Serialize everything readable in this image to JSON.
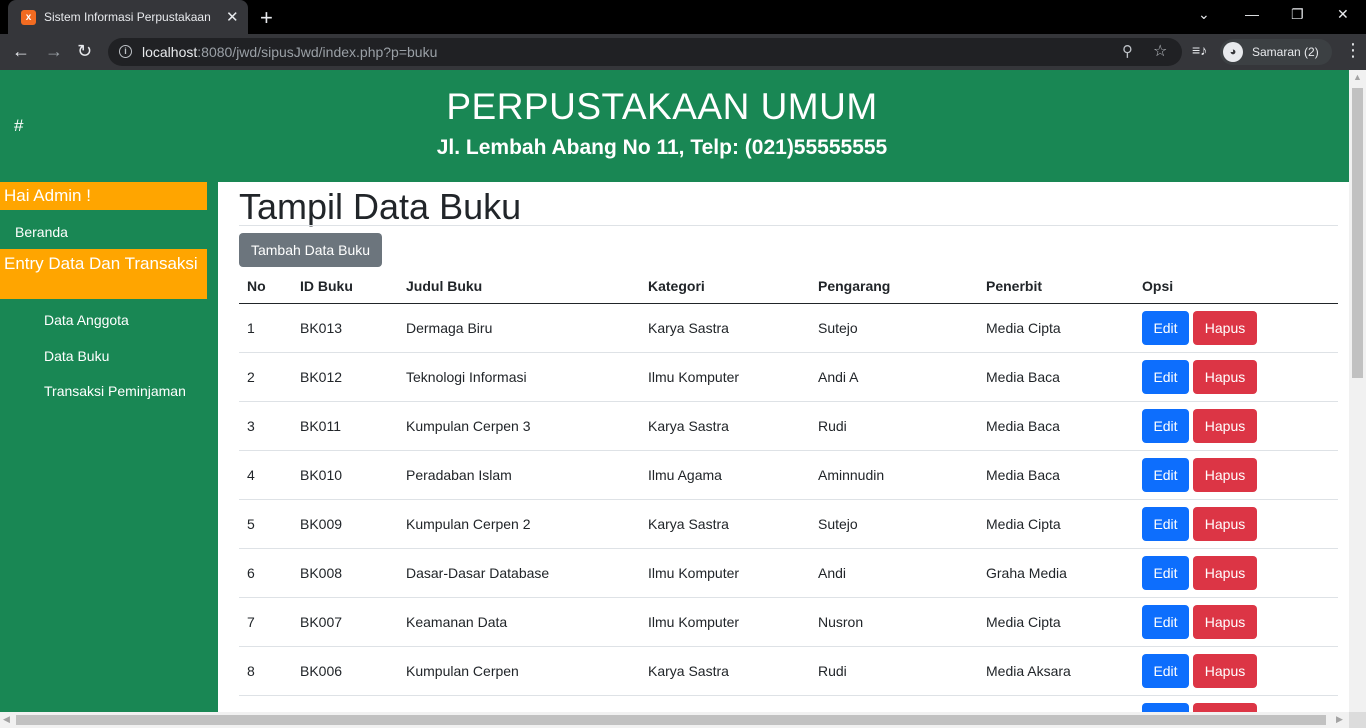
{
  "browser": {
    "tab_title": "Sistem Informasi Perpustakaan",
    "url_host": "localhost",
    "url_rest": ":8080/jwd/sipusJwd/index.php?p=buku",
    "profile_label": "Samaran (2)",
    "icons": [
      "back-icon",
      "forward-icon",
      "reload-icon",
      "info-icon",
      "zoom-icon",
      "star-icon",
      "media-icon",
      "incognito-icon",
      "menu-icon"
    ]
  },
  "header": {
    "hash": "#",
    "title": "PERPUSTAKAAN UMUM",
    "subtitle": "Jl. Lembah Abang No 11, Telp: (021)55555555",
    "bg_color": "#198754"
  },
  "sidebar": {
    "greeting": "Hai Admin !",
    "home": "Beranda",
    "section": "Entry Data Dan Transaksi",
    "items": [
      "Data Anggota",
      "Data Buku",
      "Transaksi Peminjaman"
    ],
    "accent_color": "#ffa500"
  },
  "main": {
    "title": "Tampil Data Buku",
    "add_button": "Tambah Data Buku",
    "columns": [
      "No",
      "ID Buku",
      "Judul Buku",
      "Kategori",
      "Pengarang",
      "Penerbit",
      "Opsi"
    ],
    "edit_label": "Edit",
    "delete_label": "Hapus",
    "rows": [
      [
        "1",
        "BK013",
        "Dermaga Biru",
        "Karya Sastra",
        "Sutejo",
        "Media Cipta"
      ],
      [
        "2",
        "BK012",
        "Teknologi Informasi",
        "Ilmu Komputer",
        "Andi A",
        "Media Baca"
      ],
      [
        "3",
        "BK011",
        "Kumpulan Cerpen 3",
        "Karya Sastra",
        "Rudi",
        "Media Baca"
      ],
      [
        "4",
        "BK010",
        "Peradaban Islam",
        "Ilmu Agama",
        "Aminnudin",
        "Media Baca"
      ],
      [
        "5",
        "BK009",
        "Kumpulan Cerpen 2",
        "Karya Sastra",
        "Sutejo",
        "Media Cipta"
      ],
      [
        "6",
        "BK008",
        "Dasar-Dasar Database",
        "Ilmu Komputer",
        "Andi",
        "Graha Media"
      ],
      [
        "7",
        "BK007",
        "Keamanan Data",
        "Ilmu Komputer",
        "Nusron",
        "Media Cipta"
      ],
      [
        "8",
        "BK006",
        "Kumpulan Cerpen",
        "Karya Sastra",
        "Rudi",
        "Media Aksara"
      ],
      [
        "",
        "",
        "",
        "",
        "",
        ""
      ]
    ]
  }
}
